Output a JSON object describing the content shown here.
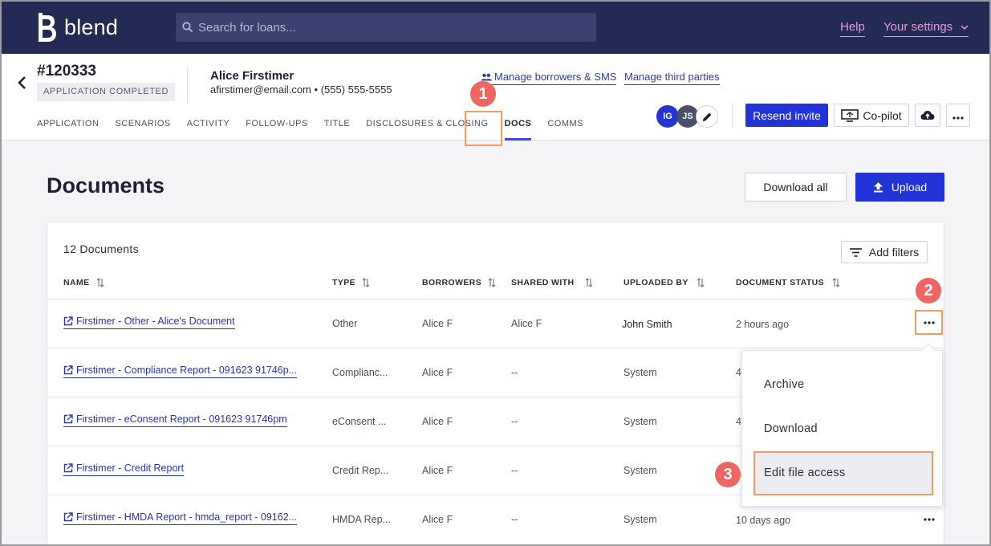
{
  "topnav": {
    "logo_text": "blend",
    "search_placeholder": "Search for loans...",
    "help_label": "Help",
    "settings_label": "Your settings"
  },
  "header": {
    "loan_id": "#120333",
    "status_badge": "APPLICATION COMPLETED",
    "borrower_name": "Alice Firstimer",
    "borrower_email": "afirstimer@email.com",
    "borrower_phone": "(555) 555-5555",
    "manage_borrowers_label": "Manage borrowers & SMS",
    "manage_third_parties_label": "Manage third parties",
    "tabs": [
      "APPLICATION",
      "SCENARIOS",
      "ACTIVITY",
      "FOLLOW-UPS",
      "TITLE",
      "DISCLOSURES & CLOSING",
      "DOCS",
      "COMMS"
    ],
    "active_tab": "DOCS",
    "avatars": [
      {
        "initials": "IG",
        "color": "#2433d1"
      },
      {
        "initials": "JS",
        "color": "#4a4f6b"
      }
    ],
    "resend_invite_label": "Resend invite",
    "copilot_label": "Co-pilot"
  },
  "main": {
    "title": "Documents",
    "download_all_label": "Download all",
    "upload_label": "Upload",
    "doc_count": "12 Documents",
    "add_filters_label": "Add filters",
    "columns": [
      "NAME",
      "TYPE",
      "BORROWERS",
      "SHARED WITH",
      "UPLOADED BY",
      "DOCUMENT STATUS"
    ],
    "rows": [
      {
        "name": "Firstimer - Other - Alice's Document",
        "type": "Other",
        "borrowers": "Alice F",
        "shared_with": "Alice F",
        "uploaded_by": "John Smith",
        "status": "2 hours ago"
      },
      {
        "name": "Firstimer - Compliance Report - 091623 91746p...",
        "type": "Complianc...",
        "borrowers": "Alice F",
        "shared_with": "--",
        "uploaded_by": "System",
        "status": "4"
      },
      {
        "name": "Firstimer - eConsent Report - 091623 91746pm",
        "type": "eConsent ...",
        "borrowers": "Alice F",
        "shared_with": "--",
        "uploaded_by": "System",
        "status": "4"
      },
      {
        "name": "Firstimer - Credit Report",
        "type": "Credit Rep...",
        "borrowers": "Alice F",
        "shared_with": "--",
        "uploaded_by": "System",
        "status": ""
      },
      {
        "name": "Firstimer - HMDA Report - hmda_report - 09162...",
        "type": "HMDA Rep...",
        "borrowers": "Alice F",
        "shared_with": "--",
        "uploaded_by": "System",
        "status": "10 days ago"
      }
    ]
  },
  "context_menu": {
    "items": [
      "Archive",
      "Download",
      "Edit file access"
    ]
  },
  "annotations": {
    "steps": [
      "1",
      "2",
      "3"
    ],
    "highlight_color": "#ee9c63",
    "step_color": "#ef6562"
  }
}
